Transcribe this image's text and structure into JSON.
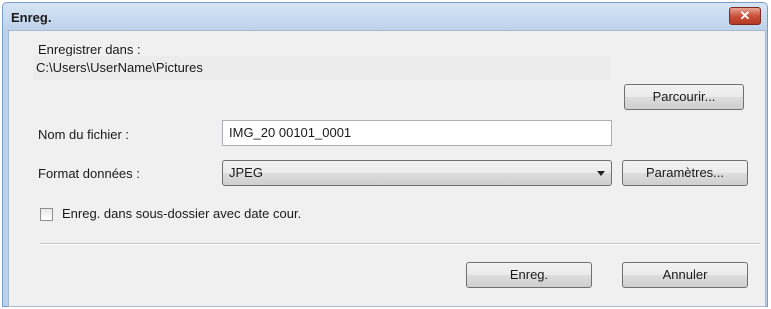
{
  "window": {
    "title": "Enreg.",
    "close_label": "✕"
  },
  "save_in": {
    "label": "Enregistrer dans :",
    "path": "C:\\Users\\UserName\\Pictures",
    "browse_label": "Parcourir..."
  },
  "file_name": {
    "label": "Nom du fichier :",
    "value": "IMG_20   00101_0001"
  },
  "data_format": {
    "label": "Format données :",
    "selected": "JPEG",
    "settings_label": "Paramètres..."
  },
  "subfolder_option": {
    "label": "Enreg. dans sous-dossier avec date cour.",
    "checked": false
  },
  "actions": {
    "save_label": "Enreg.",
    "cancel_label": "Annuler"
  }
}
